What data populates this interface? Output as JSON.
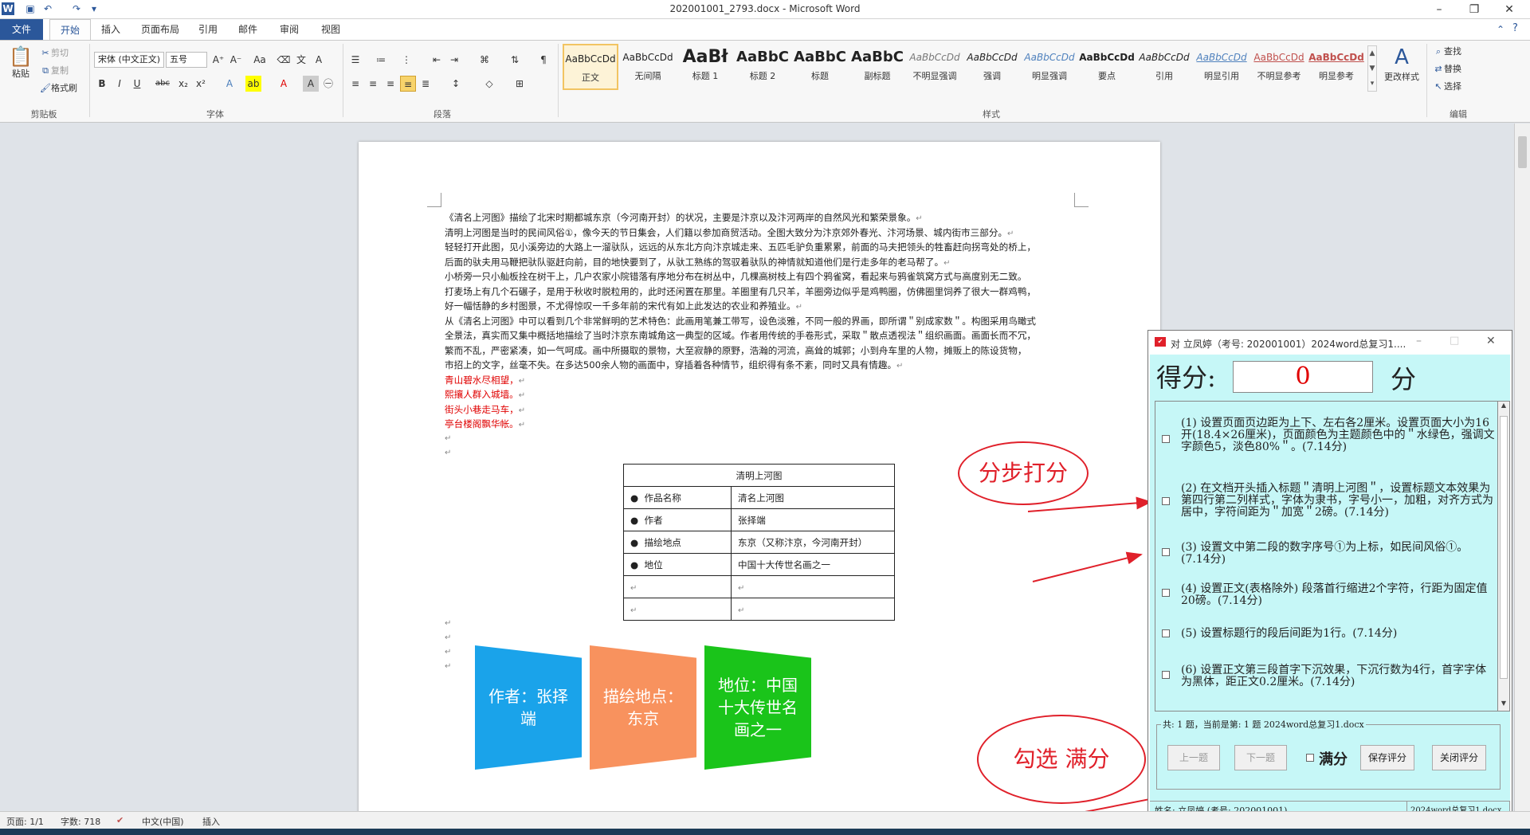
{
  "window": {
    "title": "202001001_2793.docx - Microsoft Word",
    "controls": [
      "–",
      "❐",
      "✕"
    ]
  },
  "tabs": [
    {
      "label": "文件"
    },
    {
      "label": "开始"
    },
    {
      "label": "插入"
    },
    {
      "label": "页面布局"
    },
    {
      "label": "引用"
    },
    {
      "label": "邮件"
    },
    {
      "label": "审阅"
    },
    {
      "label": "视图"
    }
  ],
  "ribbon": {
    "clipboard": {
      "paste": "粘贴",
      "cut": "剪切",
      "copy": "复制",
      "format_painter": "格式刷",
      "group": "剪贴板"
    },
    "font": {
      "name": "宋体 (中文正文)",
      "size": "五号",
      "group": "字体"
    },
    "paragraph": {
      "group": "段落"
    },
    "styles": {
      "group": "样式",
      "change": "更改样式",
      "items": [
        {
          "preview": "AaBbCcDd",
          "name": "正文"
        },
        {
          "preview": "AaBbCcDd",
          "name": "无间隔"
        },
        {
          "preview": "AaBł",
          "name": "标题 1"
        },
        {
          "preview": "AaBbC",
          "name": "标题 2"
        },
        {
          "preview": "AaBbC",
          "name": "标题"
        },
        {
          "preview": "AaBbC",
          "name": "副标题"
        },
        {
          "preview": "AaBbCcDd",
          "name": "不明显强调"
        },
        {
          "preview": "AaBbCcDd",
          "name": "强调"
        },
        {
          "preview": "AaBbCcDd",
          "name": "明显强调"
        },
        {
          "preview": "AaBbCcDd",
          "name": "要点"
        },
        {
          "preview": "AaBbCcDd",
          "name": "引用"
        },
        {
          "preview": "AaBbCcDd",
          "name": "明显引用"
        },
        {
          "preview": "AaBbCcDd",
          "name": "不明显参考"
        },
        {
          "preview": "AaBbCcDd",
          "name": "明显参考"
        }
      ]
    },
    "editing": {
      "find": "查找",
      "replace": "替换",
      "select": "选择",
      "group": "编辑"
    }
  },
  "document": {
    "paragraphs": [
      "《清名上河图》描绘了北宋时期都城东京（今河南开封）的状况，主要是汴京以及汴河两岸的自然风光和繁荣景象。",
      "清明上河图是当时的民间风俗①，像今天的节日集会，人们籍以参加商贸活动。全图大致分为汴京郊外春光、汴河场景、城内街市三部分。",
      "轻轻打开此图，见小溪旁边的大路上一溜驮队，远远的从东北方向汴京城走来、五匹毛驴负重累累，前面的马夫把领头的牲畜赶向拐弯处的桥上，",
      "后面的驮夫用马鞭把驮队驱赶向前，目的地快要到了，从驮工熟练的驾驭着驮队的神情就知道他们是行走多年的老马帮了。",
      "小桥旁一只小舢板拴在树干上，几户农家小院错落有序地分布在树丛中，几棵高树枝上有四个鸦雀窝，看起来与鸦雀筑窝方式与高度别无二致。",
      "打麦场上有几个石碾子，是用于秋收时脱粒用的，此时还闲置在那里。羊圈里有几只羊，羊圈旁边似乎是鸡鸭圈，仿佛圈里饲养了很大一群鸡鸭，",
      "好一幅恬静的乡村图景，不尤得惊叹一千多年前的宋代有如上此发达的农业和养殖业。",
      "从《清名上河图》中可以看到几个非常鲜明的艺术特色：此画用笔兼工带写，设色淡雅，不同一般的界画，即所谓＂别成家数＂。构图采用鸟瞰式",
      "全景法，真实而又集中概括地描绘了当时汴京东南城角这一典型的区域。作者用传统的手卷形式，采取＂散点透视法＂组织画面。画面长而不冗，",
      "繁而不乱，严密紧凑，如一气呵成。画中所摄取的景物，大至寂静的原野，浩瀚的河流，高耸的城郭；小到舟车里的人物，摊贩上的陈设货物，",
      "市招上的文字，丝毫不失。在多达500余人物的画面中，穿插着各种情节，组织得有条不紊，同时又具有情趣。"
    ],
    "poem": [
      "青山碧水尽相望，",
      "熙攘人群入城墙。",
      "街头小巷走马车，",
      "亭台楼阁飘华帐。"
    ],
    "para_mark": "↵",
    "table": {
      "header": "清明上河图",
      "rows": [
        {
          "bullet": "●",
          "label": "作品名称",
          "value": "清名上河图"
        },
        {
          "bullet": "●",
          "label": "作者",
          "value": "张择端"
        },
        {
          "bullet": "●",
          "label": "描绘地点",
          "value": "东京（又称汴京，今河南开封）"
        },
        {
          "bullet": "●",
          "label": "地位",
          "value": "中国十大传世名画之一"
        },
        {
          "bullet": "",
          "label": "",
          "value": ""
        },
        {
          "bullet": "",
          "label": "",
          "value": ""
        }
      ]
    },
    "smartart": [
      {
        "text": "作者：张择端",
        "color": "#1aa3ea"
      },
      {
        "text": "描绘地点：东京",
        "color": "#f8925e"
      },
      {
        "text": "地位：中国十大传世名画之一",
        "color": "#1ac41a"
      }
    ]
  },
  "statusbar": {
    "page": "页面: 1/1",
    "words": "字数: 718",
    "lang": "中文(中国)",
    "mode": "插入"
  },
  "dialog": {
    "title": "对 立凤婷（考号: 202001001）2024word总复习1....",
    "score_label": "得分:",
    "score_value": "0",
    "score_unit": "分",
    "items": [
      "(1) 设置页面页边距为上下、左右各2厘米。设置页面大小为16开(18.4×26厘米)，页面颜色为主题颜色中的＂水绿色，强调文字颜色5，淡色80%＂。(7.14分)",
      "(2) 在文档开头插入标题＂清明上河图＂，设置标题文本效果为第四行第二列样式，字体为隶书，字号小一，加粗，对齐方式为居中，字符间距为＂加宽＂2磅。(7.14分)",
      "(3) 设置文中第二段的数字序号①为上标，如民间风俗①。(7.14分)",
      "(4) 设置正文(表格除外) 段落首行缩进2个字符，行距为固定值20磅。(7.14分)",
      "(5) 设置标题行的段后间距为1行。(7.14分)",
      "(6) 设置正文第三段首字下沉效果，下沉行数为4行，首字字体为黑体，距正文0.2厘米。(7.14分)"
    ],
    "group_label": "共: 1 题，当前是第: 1 题 2024word总复习1.docx",
    "prev": "上一题",
    "next": "下一题",
    "full_marks": "满分",
    "save": "保存评分",
    "close": "关闭评分",
    "footer_left": "姓名: 立凤婷 (考号: 202001001)",
    "footer_right": "2024word总复习1.docx"
  },
  "annotations": {
    "step": "分步打分",
    "check": "勾选  满分",
    "color": "#e0202a"
  }
}
